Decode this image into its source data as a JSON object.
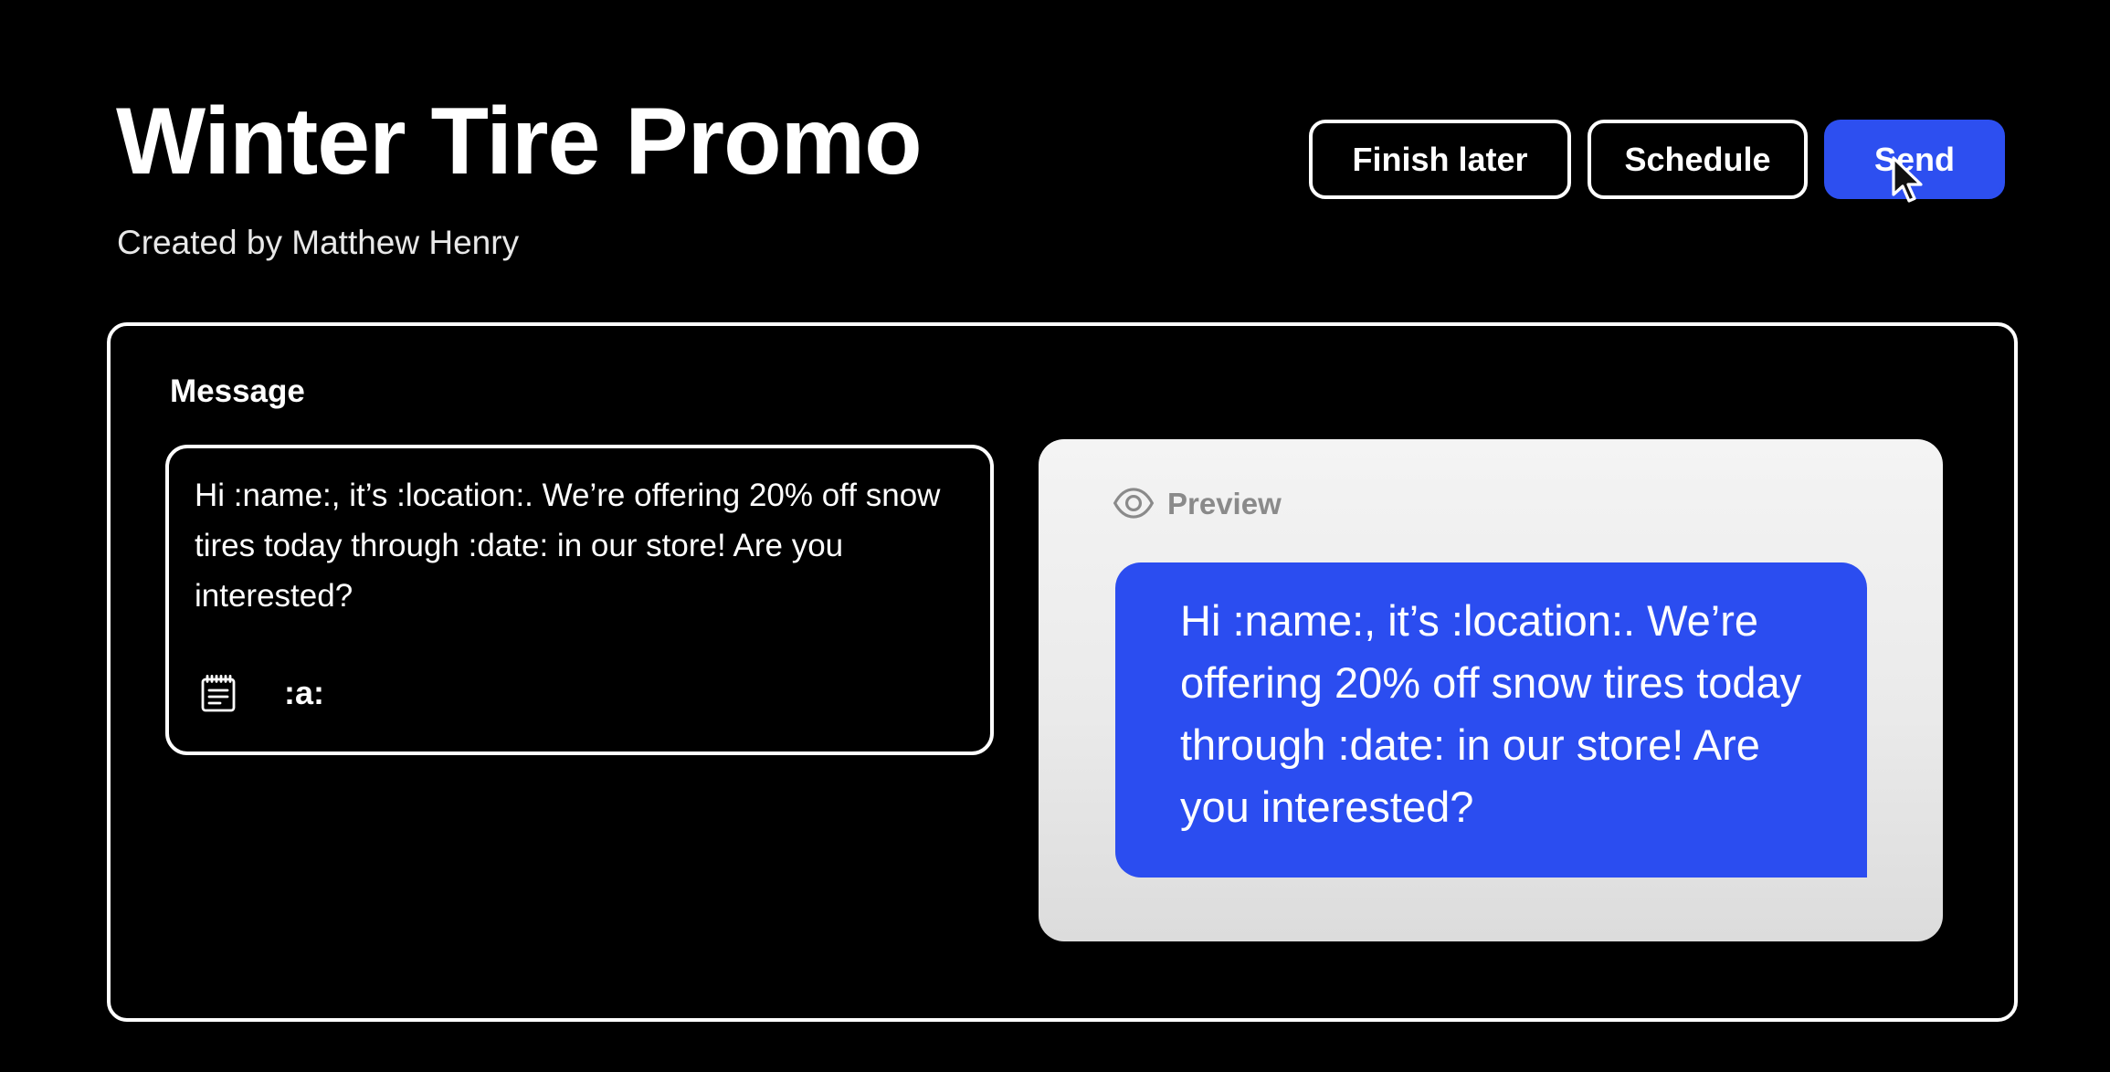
{
  "header": {
    "title": "Winter Tire Promo",
    "subtitle": "Created by Matthew Henry"
  },
  "actions": {
    "finish_later": "Finish later",
    "schedule": "Schedule",
    "send": "Send"
  },
  "message": {
    "label": "Message",
    "text": "Hi :name:, it’s :location:. We’re offering 20% off snow tires today through :date: in our store! Are you interested?",
    "toolbar_icon": "notes-icon",
    "token": ":a:"
  },
  "preview": {
    "label": "Preview",
    "icon": "eye-icon",
    "text": "Hi :name:, it’s :location:. We’re offering 20% off snow tires today through :date: in our store! Are you interested?"
  },
  "colors": {
    "background": "#000000",
    "accent": "#2d4ff0",
    "preview_card": "#eeeeee",
    "preview_label": "#8a8a8a"
  }
}
